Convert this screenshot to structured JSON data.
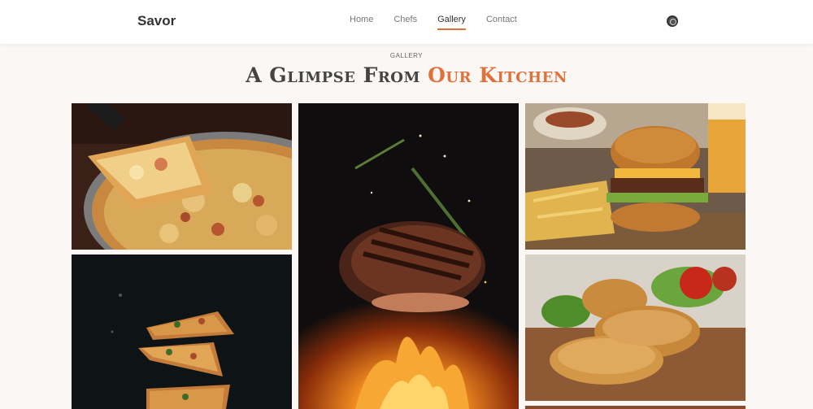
{
  "brand": "Savor",
  "nav": {
    "items": [
      {
        "label": "Home",
        "active": false
      },
      {
        "label": "Chefs",
        "active": false
      },
      {
        "label": "Gallery",
        "active": true
      },
      {
        "label": "Contact",
        "active": false
      }
    ],
    "icon": "profile-icon"
  },
  "section": {
    "eyebrow": "GALLERY",
    "title_main": "A Glimpse From ",
    "title_accent": "Our Kitchen"
  },
  "gallery": [
    {
      "subject": "pizza-photo"
    },
    {
      "subject": "pizza-slices-photo"
    },
    {
      "subject": "grilled-steak-photo"
    },
    {
      "subject": "burger-photo"
    },
    {
      "subject": "fried-chicken-photo"
    },
    {
      "subject": "dish-photo"
    }
  ],
  "colors": {
    "accent": "#e0713a",
    "background": "#faf7f5",
    "navbar": "#ffffff"
  }
}
